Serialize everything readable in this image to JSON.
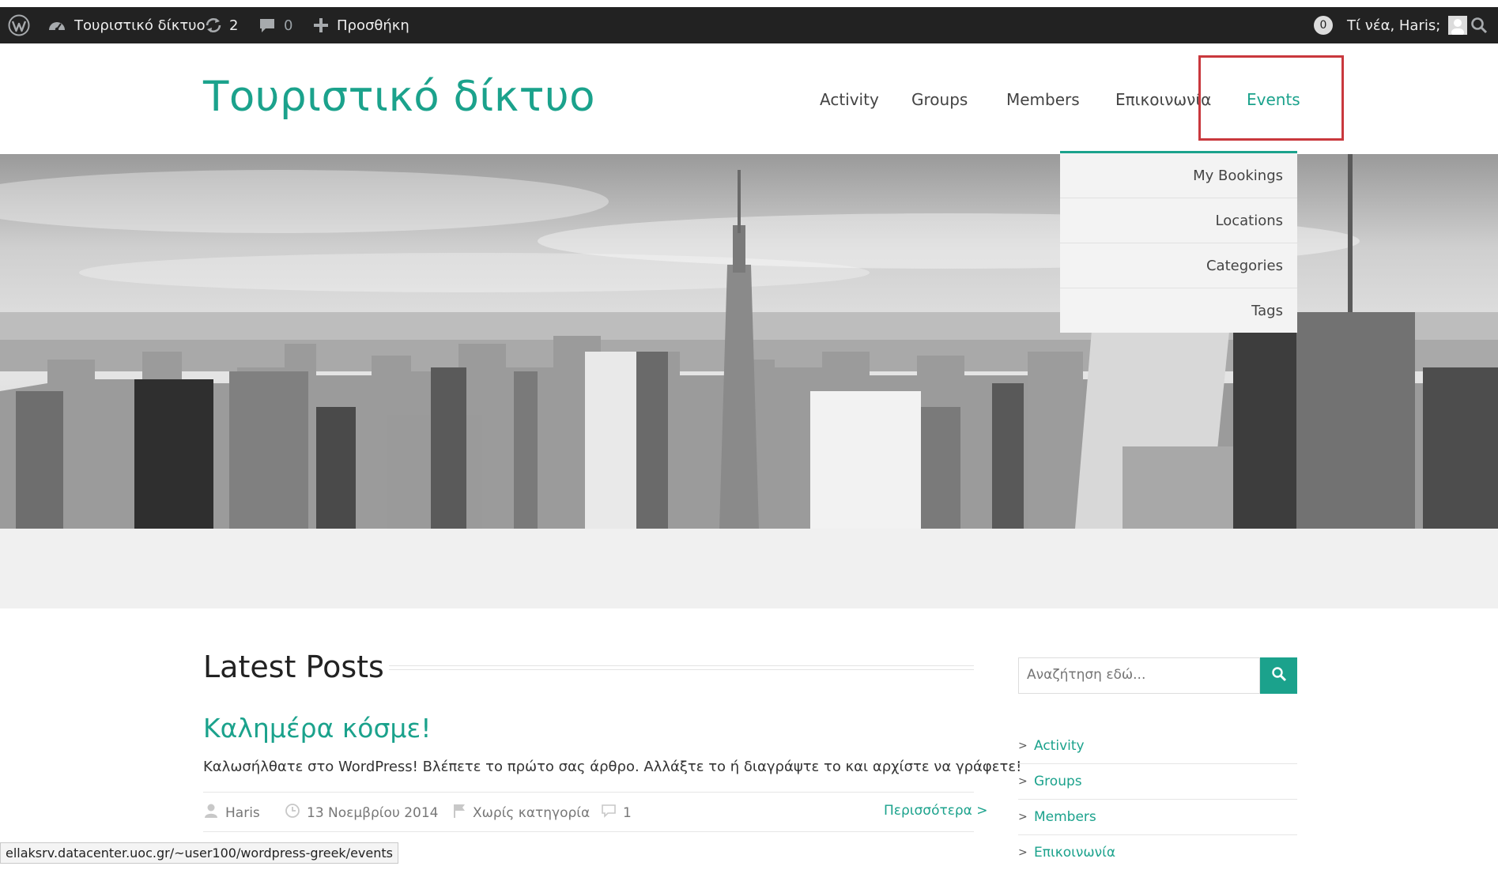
{
  "admin_bar": {
    "site_name": "Τουριστικό δίκτυο",
    "updates_count": "2",
    "comments_count": "0",
    "new_label": "Προσθήκη",
    "notifications_count": "0",
    "greeting": "Τί νέα, Haris;",
    "icons": [
      "wordpress-logo-icon",
      "dashboard-icon",
      "refresh-icon",
      "comment-icon",
      "plus-icon",
      "avatar",
      "search-icon"
    ]
  },
  "header": {
    "site_title": "Τουριστικό δίκτυο",
    "nav": [
      "Activity",
      "Groups",
      "Members",
      "Επικοινωνία",
      "Events"
    ],
    "active_nav": "Events"
  },
  "events_dropdown": [
    "My Bookings",
    "Locations",
    "Categories",
    "Tags"
  ],
  "main": {
    "section_title": "Latest Posts",
    "post": {
      "title": "Καλημέρα κόσμε!",
      "excerpt": "Καλωσήλθατε στο WordPress! Βλέπετε το πρώτο σας άρθρο. Αλλάξτε το ή διαγράψτε το και αρχίστε να γράφετε!",
      "author": "Haris",
      "date": "13 Νοεμβρίου 2014",
      "category": "Χωρίς κατηγορία",
      "comments": "1",
      "more": "Περισσότερα >"
    }
  },
  "sidebar": {
    "search_placeholder": "Αναζήτηση εδώ...",
    "links": [
      "Activity",
      "Groups",
      "Members",
      "Επικοινωνία"
    ]
  },
  "status_url": "ellaksrv.datacenter.uoc.gr/~user100/wordpress-greek/events",
  "colors": {
    "accent": "#1ba28c",
    "admin_bar": "#222222",
    "highlight_box": "#c9383d"
  }
}
